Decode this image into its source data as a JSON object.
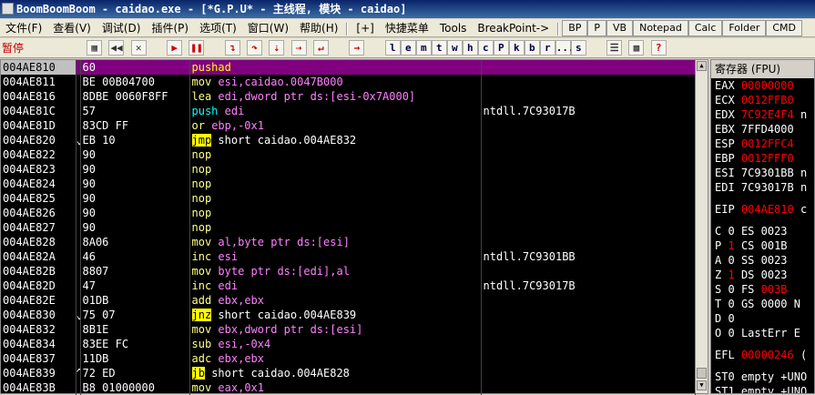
{
  "window": {
    "title": "BoomBoomBoom - caidao.exe - [*G.P.U* -  主线程, 模块 - caidao]"
  },
  "menu": {
    "items": [
      "文件(F)",
      "查看(V)",
      "调试(D)",
      "插件(P)",
      "选项(T)",
      "窗口(W)",
      "帮助(H)",
      "[+]",
      "快捷菜单",
      "Tools",
      "BreakPoint->"
    ],
    "buttons": [
      "BP",
      "P",
      "VB",
      "Notepad",
      "Calc",
      "Folder",
      "CMD"
    ]
  },
  "toolbar": {
    "status": "暂停",
    "letters": [
      "l",
      "e",
      "m",
      "t",
      "w",
      "h",
      "c",
      "P",
      "k",
      "b",
      "r",
      "...",
      "s"
    ]
  },
  "disasm": [
    {
      "addr": "004AE810",
      "arrow": "",
      "hex": "60",
      "mn": "pushad",
      "ops": "",
      "cmt": "",
      "sel": true
    },
    {
      "addr": "004AE811",
      "arrow": "",
      "hex": "BE 00B04700",
      "mn": "mov",
      "ops": "esi,caidao.0047B000",
      "cmt": ""
    },
    {
      "addr": "004AE816",
      "arrow": "",
      "hex": "8DBE 0060F8FF",
      "mn": "lea",
      "ops": "edi,dword ptr ds:[esi-0x7A000]",
      "cmt": ""
    },
    {
      "addr": "004AE81C",
      "arrow": "",
      "hex": "57",
      "mn": "push",
      "ops": "edi",
      "cmt": "ntdll.7C93017B"
    },
    {
      "addr": "004AE81D",
      "arrow": "",
      "hex": "83CD FF",
      "mn": "or",
      "ops": "ebp,-0x1",
      "cmt": ""
    },
    {
      "addr": "004AE820",
      "arrow": "⌄",
      "hex": "EB 10",
      "mn": "jmp",
      "ops": "short caidao.004AE832",
      "cmt": ""
    },
    {
      "addr": "004AE822",
      "arrow": "",
      "hex": "90",
      "mn": "nop",
      "ops": "",
      "cmt": ""
    },
    {
      "addr": "004AE823",
      "arrow": "",
      "hex": "90",
      "mn": "nop",
      "ops": "",
      "cmt": ""
    },
    {
      "addr": "004AE824",
      "arrow": "",
      "hex": "90",
      "mn": "nop",
      "ops": "",
      "cmt": ""
    },
    {
      "addr": "004AE825",
      "arrow": "",
      "hex": "90",
      "mn": "nop",
      "ops": "",
      "cmt": ""
    },
    {
      "addr": "004AE826",
      "arrow": "",
      "hex": "90",
      "mn": "nop",
      "ops": "",
      "cmt": ""
    },
    {
      "addr": "004AE827",
      "arrow": "",
      "hex": "90",
      "mn": "nop",
      "ops": "",
      "cmt": ""
    },
    {
      "addr": "004AE828",
      "arrow": "",
      "hex": "8A06",
      "mn": "mov",
      "ops": "al,byte ptr ds:[esi]",
      "cmt": ""
    },
    {
      "addr": "004AE82A",
      "arrow": "",
      "hex": "46",
      "mn": "inc",
      "ops": "esi",
      "cmt": "ntdll.7C9301BB"
    },
    {
      "addr": "004AE82B",
      "arrow": "",
      "hex": "8807",
      "mn": "mov",
      "ops": "byte ptr ds:[edi],al",
      "cmt": ""
    },
    {
      "addr": "004AE82D",
      "arrow": "",
      "hex": "47",
      "mn": "inc",
      "ops": "edi",
      "cmt": "ntdll.7C93017B"
    },
    {
      "addr": "004AE82E",
      "arrow": "",
      "hex": "01DB",
      "mn": "add",
      "ops": "ebx,ebx",
      "cmt": ""
    },
    {
      "addr": "004AE830",
      "arrow": "⌄",
      "hex": "75 07",
      "mn": "jnz",
      "ops": "short caidao.004AE839",
      "cmt": ""
    },
    {
      "addr": "004AE832",
      "arrow": "",
      "hex": "8B1E",
      "mn": "mov",
      "ops": "ebx,dword ptr ds:[esi]",
      "cmt": ""
    },
    {
      "addr": "004AE834",
      "arrow": "",
      "hex": "83EE FC",
      "mn": "sub",
      "ops": "esi,-0x4",
      "cmt": ""
    },
    {
      "addr": "004AE837",
      "arrow": "",
      "hex": "11DB",
      "mn": "adc",
      "ops": "ebx,ebx",
      "cmt": ""
    },
    {
      "addr": "004AE839",
      "arrow": "^",
      "hex": "72 ED",
      "mn": "jb",
      "ops": "short caidao.004AE828",
      "cmt": ""
    },
    {
      "addr": "004AE83B",
      "arrow": "",
      "hex": "B8 01000000",
      "mn": "mov",
      "ops": "eax,0x1",
      "cmt": ""
    }
  ],
  "registers": {
    "title": "寄存器 (FPU)",
    "rows": [
      {
        "name": "EAX",
        "value": "00000000",
        "red": true,
        "extra": ""
      },
      {
        "name": "ECX",
        "value": "0012FFB0",
        "red": true,
        "extra": ""
      },
      {
        "name": "EDX",
        "value": "7C92E4F4",
        "red": true,
        "extra": "n"
      },
      {
        "name": "EBX",
        "value": "7FFD4000",
        "red": false,
        "extra": ""
      },
      {
        "name": "ESP",
        "value": "0012FFC4",
        "red": true,
        "extra": ""
      },
      {
        "name": "EBP",
        "value": "0012FFF0",
        "red": true,
        "extra": ""
      },
      {
        "name": "ESI",
        "value": "7C9301BB",
        "red": false,
        "extra": "n"
      },
      {
        "name": "EDI",
        "value": "7C93017B",
        "red": false,
        "extra": "n"
      }
    ],
    "eip": {
      "name": "EIP",
      "value": "004AE810",
      "extra": "c"
    },
    "flags": [
      {
        "f": "C",
        "v": "0",
        "seg": "ES",
        "sv": "0023",
        "red": false
      },
      {
        "f": "P",
        "v": "1",
        "seg": "CS",
        "sv": "001B",
        "red": true
      },
      {
        "f": "A",
        "v": "0",
        "seg": "SS",
        "sv": "0023",
        "red": false
      },
      {
        "f": "Z",
        "v": "1",
        "seg": "DS",
        "sv": "0023",
        "red": true
      },
      {
        "f": "S",
        "v": "0",
        "seg": "FS",
        "sv": "003B",
        "red": false,
        "svred": true
      },
      {
        "f": "T",
        "v": "0",
        "seg": "GS",
        "sv": "0000",
        "red": false,
        "extra": "N"
      },
      {
        "f": "D",
        "v": "0",
        "seg": "",
        "sv": "",
        "red": false
      },
      {
        "f": "O",
        "v": "0",
        "seg": "LastErr",
        "sv": "E",
        "red": false
      }
    ],
    "efl": {
      "name": "EFL",
      "value": "00000246",
      "extra": "("
    },
    "st": [
      {
        "name": "ST0",
        "value": "empty +UNO"
      },
      {
        "name": "ST1",
        "value": "empty +UNO"
      }
    ]
  }
}
